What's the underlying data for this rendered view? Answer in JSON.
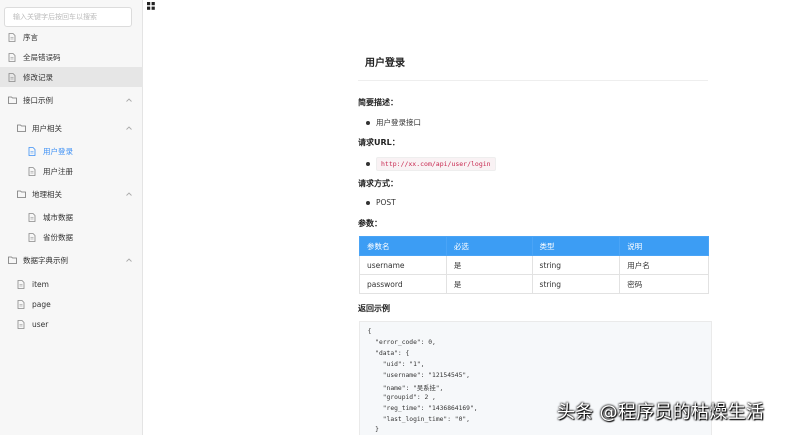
{
  "sidebar": {
    "search_placeholder": "输入关键字后按回车以搜索",
    "items": [
      {
        "label": "序言"
      },
      {
        "label": "全局错误码"
      },
      {
        "label": "修改记录"
      },
      {
        "label": "接口示例"
      },
      {
        "label": "用户相关"
      },
      {
        "label": "用户登录"
      },
      {
        "label": "用户注册"
      },
      {
        "label": "地理相关"
      },
      {
        "label": "城市数据"
      },
      {
        "label": "省份数据"
      },
      {
        "label": "数据字典示例"
      },
      {
        "label": "item"
      },
      {
        "label": "page"
      },
      {
        "label": "user"
      }
    ]
  },
  "doc": {
    "title": "用户登录",
    "summary_heading": "简要描述：",
    "summary_text": "用户登录接口",
    "url_heading": "请求URL：",
    "url": "http://xx.com/api/user/login",
    "method_heading": "请求方式：",
    "method": "POST",
    "params_heading": "参数：",
    "params_table": {
      "headers": [
        "参数名",
        "必选",
        "类型",
        "说明"
      ],
      "rows": [
        [
          "username",
          "是",
          "string",
          "用户名"
        ],
        [
          "password",
          "是",
          "string",
          "密码"
        ]
      ]
    },
    "response_heading": "返回示例",
    "code_lines": [
      "  {",
      "    \"error_code\": 0,",
      "    \"data\": {",
      "      \"uid\": \"1\",",
      "      \"username\": \"12154545\",",
      "      \"name\": \"吴系挂\",",
      "      \"groupid\": 2 ,",
      "      \"reg_time\": \"1436864169\",",
      "      \"last_login_time\": \"0\",",
      "    }"
    ]
  },
  "watermark": "头条 @程序员的枯燥生活",
  "colors": {
    "accent": "#3c9df4",
    "sidebar_bg": "#f7f7f7",
    "active_item_bg": "#e6e6e6",
    "inline_code": "#c7254e"
  }
}
